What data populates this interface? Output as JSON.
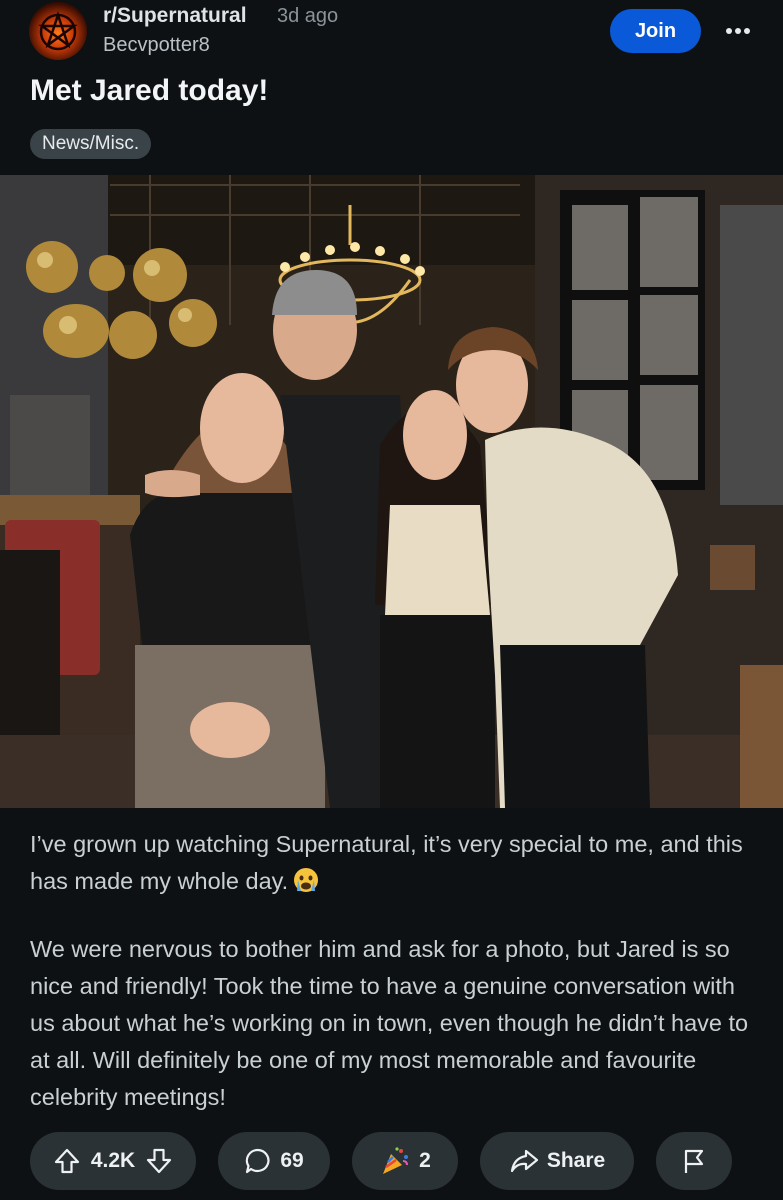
{
  "header": {
    "subreddit": "r/Supernatural",
    "age": "3d ago",
    "username": "Becvpotter8",
    "join_label": "Join"
  },
  "post": {
    "title": "Met Jared today!",
    "flair": "News/Misc.",
    "paragraphs": [
      "I’ve grown up watching Supernatural, it’s very special to me, and this has made my whole day.",
      "We were nervous to bother him and ask for a photo, but Jared is so nice and friendly! Took the time to have a genuine conversation with us about what he’s working on in town, even though he didn’t have to at all. Will definitely be one of my most memorable and favourite celebrity meetings!"
    ]
  },
  "actions": {
    "votes": "4.2K",
    "comments": "69",
    "awards": "2",
    "share_label": "Share"
  },
  "colors": {
    "background": "#0e1113",
    "accent": "#0a59d8",
    "pill": "#2a3236"
  },
  "icons": [
    "pentagram-icon",
    "more-icon",
    "upvote-icon",
    "downvote-icon",
    "comment-icon",
    "award-icon",
    "share-icon",
    "report-flag-icon",
    "crying-face-icon"
  ]
}
